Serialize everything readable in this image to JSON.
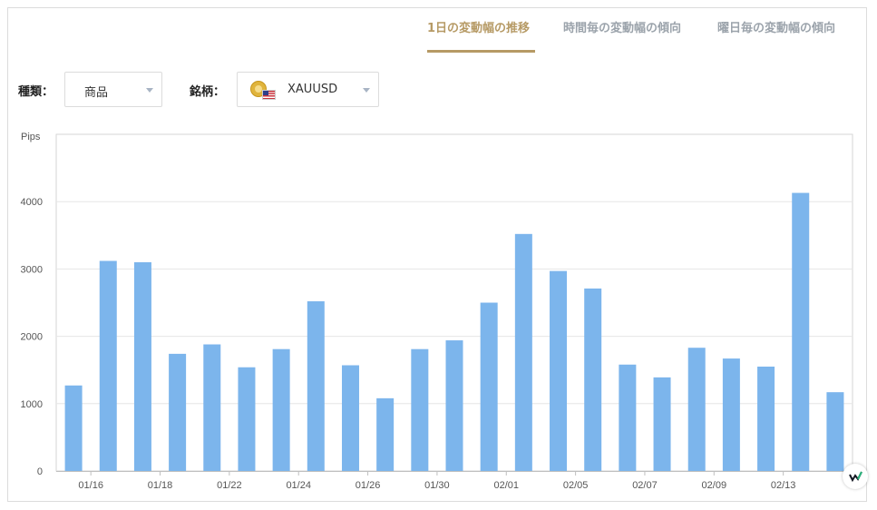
{
  "tabs": [
    {
      "label": "1日の変動幅の推移",
      "active": true
    },
    {
      "label": "時間毎の変動幅の傾向",
      "active": false
    },
    {
      "label": "曜日毎の変動幅の傾向",
      "active": false
    }
  ],
  "filters": {
    "type_label": "種類：",
    "type_value": "商品",
    "symbol_label": "銘柄：",
    "symbol_value": "XAUUSD",
    "symbol_icon": "gold-coin-icon",
    "flag_icon": "us-flag-icon"
  },
  "colors": {
    "accent": "#b69a65",
    "bar": "#7cb5ec",
    "tab_inactive": "#9ba3ab"
  },
  "chart_data": {
    "type": "bar",
    "ylabel": "Pips",
    "ylim": [
      0,
      5000
    ],
    "yticks": [
      0,
      1000,
      2000,
      3000,
      4000
    ],
    "grid": true,
    "x_tick_labels": [
      "01/16",
      "01/18",
      "01/22",
      "01/24",
      "01/26",
      "01/30",
      "02/01",
      "02/05",
      "02/07",
      "02/09",
      "02/13"
    ],
    "values": [
      1270,
      3120,
      3100,
      1740,
      1880,
      1540,
      1810,
      2520,
      1570,
      1080,
      1810,
      1940,
      2500,
      3520,
      2970,
      2710,
      1580,
      1390,
      1830,
      1670,
      1550,
      4130,
      1170
    ]
  }
}
